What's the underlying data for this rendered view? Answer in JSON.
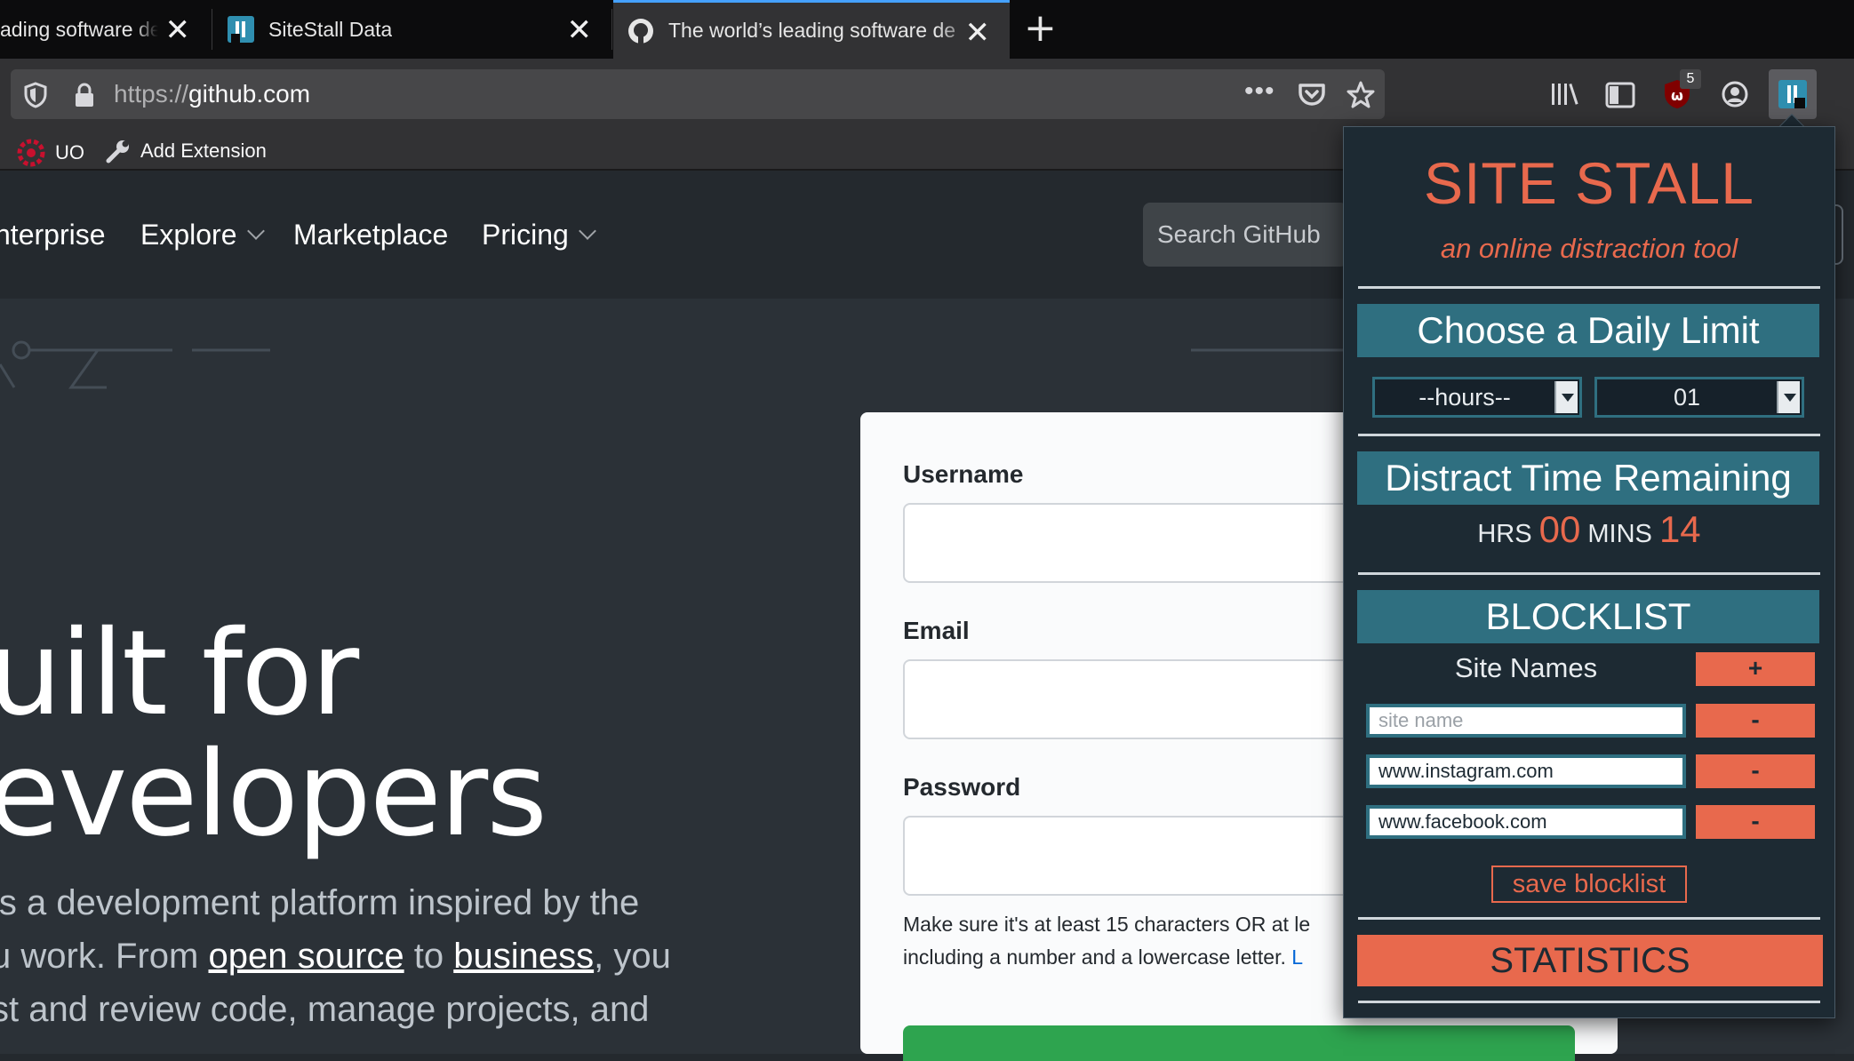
{
  "browser": {
    "tabs": [
      {
        "title": "ading software de",
        "active": false
      },
      {
        "title": "SiteStall Data",
        "active": false
      },
      {
        "title": "The world’s leading software de",
        "active": true
      }
    ],
    "url_scheme": "https://",
    "url_host": "github.com",
    "toolbar": {
      "ublock_badge": "5"
    },
    "bookmarks": [
      {
        "label": "UO"
      },
      {
        "label": "Add Extension"
      }
    ]
  },
  "github": {
    "nav": [
      {
        "label": "nterprise"
      },
      {
        "label": "Explore"
      },
      {
        "label": "Marketplace"
      },
      {
        "label": "Pricing"
      }
    ],
    "search_placeholder": "Search GitHub",
    "hero": {
      "line1": "uilt for",
      "line2": "evelopers",
      "text_1": "is a development platform inspired by the",
      "text_2a": "u work. From ",
      "text_2_link1": "open source",
      "text_2b": " to ",
      "text_2_link2": "business",
      "text_2c": ", you",
      "text_3": "st and review code, manage projects, and"
    },
    "signup": {
      "username_label": "Username",
      "email_label": "Email",
      "password_label": "Password",
      "hint_1": "Make sure it's at least 15 characters OR at le",
      "hint_2": "including a number and a lowercase letter. ",
      "hint_link": "L"
    }
  },
  "sitestall": {
    "title": "SITE STALL",
    "subtitle": "an online distraction tool",
    "daily_limit_header": "Choose a Daily Limit",
    "hours_select": "--hours--",
    "minutes_select": "01",
    "remaining_header": "Distract Time Remaining",
    "hrs_label": "HRS",
    "hrs_value": "00",
    "mins_label": "MINS",
    "mins_value": "14",
    "blocklist_header": "BLOCKLIST",
    "site_names_label": "Site Names",
    "add_button": "+",
    "site_name_placeholder": "site name",
    "sites": [
      "www.instagram.com",
      "www.facebook.com"
    ],
    "remove_button": "-",
    "save_button": "save blocklist",
    "statistics_button": "STATISTICS",
    "colors": {
      "accent": "#e8694d",
      "band": "#2f6f80",
      "background": "#1d2a33"
    }
  }
}
